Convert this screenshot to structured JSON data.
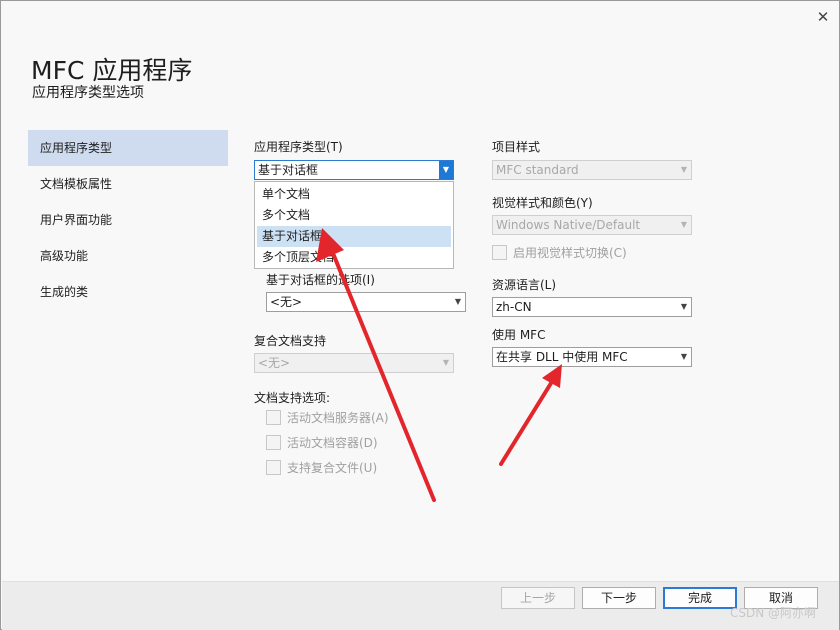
{
  "dialog": {
    "close_glyph": "✕",
    "title": "MFC 应用程序",
    "subtitle": "应用程序类型选项"
  },
  "nav": {
    "items": [
      {
        "label": "应用程序类型",
        "selected": true
      },
      {
        "label": "文档模板属性",
        "selected": false
      },
      {
        "label": "用户界面功能",
        "selected": false
      },
      {
        "label": "高级功能",
        "selected": false
      },
      {
        "label": "生成的类",
        "selected": false
      }
    ]
  },
  "app_type": {
    "label": "应用程序类型(T)",
    "value": "基于对话框",
    "options": [
      "单个文档",
      "多个文档",
      "基于对话框",
      "多个顶层文档"
    ],
    "highlighted_option": "基于对话框"
  },
  "dialog_options": {
    "label": "基于对话框的选项(I)",
    "value": "<无>"
  },
  "compound_doc": {
    "label": "复合文档支持",
    "value": "<无>"
  },
  "doc_support": {
    "label": "文档支持选项:",
    "checkboxes": [
      "活动文档服务器(A)",
      "活动文档容器(D)",
      "支持复合文件(U)"
    ]
  },
  "project_style": {
    "label": "项目样式",
    "value": "MFC standard"
  },
  "visual_style": {
    "label": "视觉样式和颜色(Y)",
    "value": "Windows Native/Default",
    "toggle_label": "启用视觉样式切换(C)"
  },
  "resource_lang": {
    "label": "资源语言(L)",
    "value": "zh-CN"
  },
  "use_mfc": {
    "label": "使用 MFC",
    "value": "在共享 DLL 中使用 MFC"
  },
  "buttons": {
    "back": "上一步",
    "next": "下一步",
    "finish": "完成",
    "cancel": "取消"
  },
  "watermark": "CSDN @阿亦啊",
  "colors": {
    "accent": "#1e78d6",
    "nav_selected": "#cfdcf0",
    "annotation_arrow": "#e3262b"
  }
}
